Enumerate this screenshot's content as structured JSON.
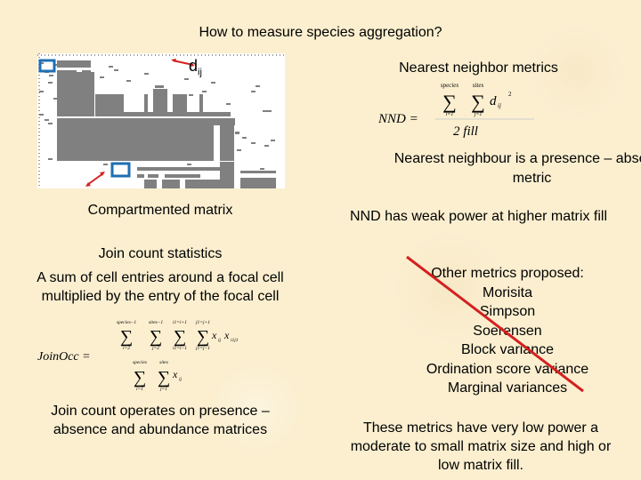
{
  "title": "How to measure species aggregation?",
  "matrix": {
    "caption": "Compartmented matrix",
    "distance_label": "d",
    "distance_subscript": "ij",
    "highlight_color": "#1f6fb2",
    "arrow_color": "#d42020",
    "cell_color": "#808080"
  },
  "nnd": {
    "heading": "Nearest neighbor metrics",
    "formula": {
      "lhs": "NND =",
      "sum1_top": "species",
      "sum1_bottom": "i=1",
      "sum2_top": "sites",
      "sum2_bottom": "j=1",
      "term": "d",
      "term_sub": "ij",
      "term_sup": "2",
      "denominator": "2 fill"
    },
    "note1": "Nearest neighbour is a presence – absence metric",
    "note2": "NND has weak power at higher matrix fill"
  },
  "join_count": {
    "heading": "Join count statistics",
    "description_line1": "A sum of cell entries around a focal cell",
    "description_line2": "multiplied by the entry of the focal cell",
    "formula": {
      "lhs": "JoinOcc =",
      "num_sums": [
        {
          "top": "species−1",
          "bottom": "i=2"
        },
        {
          "top": "sites−1",
          "bottom": "j=2"
        },
        {
          "top": "i1=i+1",
          "bottom": "i1=i−1"
        },
        {
          "top": "j1=j+1",
          "bottom": "j1=j−1"
        }
      ],
      "num_term": "x",
      "num_term_sub": "ij",
      "num_term2": "x",
      "num_term2_sub": "i1j1",
      "den_sums": [
        {
          "top": "species",
          "bottom": "i=1"
        },
        {
          "top": "sites",
          "bottom": "j=1"
        }
      ],
      "den_term": "x",
      "den_term_sub": "ij"
    },
    "note_line1": "Join count operates on presence –",
    "note_line2": "absence and abundance matrices"
  },
  "other_metrics": {
    "heading": "Other metrics proposed:",
    "items": [
      "Morisita",
      "Simpson",
      "Soerensen",
      "Block variance",
      "Ordination score variance",
      "Marginal variances"
    ],
    "strike_color": "#d42020",
    "conclusion_line1": "These metrics have very low power a",
    "conclusion_line2": "moderate to small matrix size and high or",
    "conclusion_line3": "low matrix fill."
  }
}
